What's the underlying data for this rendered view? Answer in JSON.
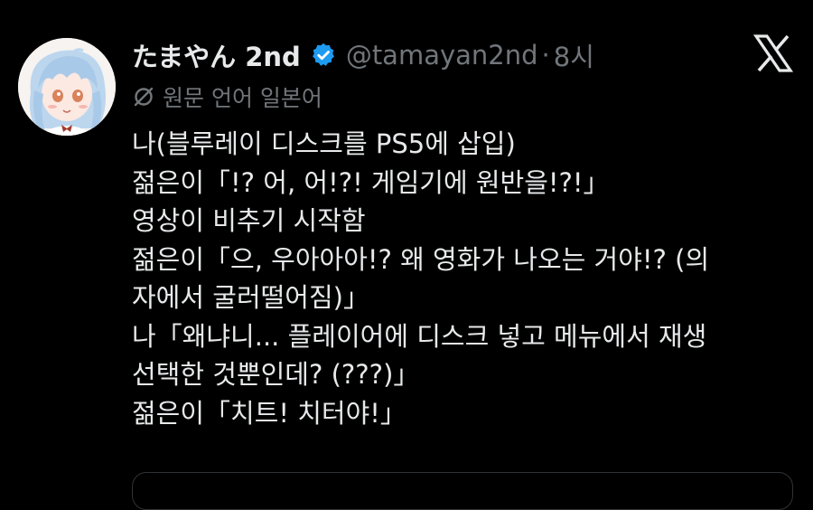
{
  "tweet": {
    "display_name": "たまやん 2nd",
    "handle": "@tamayan2nd",
    "separator": "·",
    "time": "8시",
    "original_language": "원문 언어 일본어",
    "body_lines": [
      "나(블루레이 디스크를 PS5에 삽입)",
      "젊은이「!? 어, 어!?! 게임기에 원반을!?!」",
      "영상이 비추기 시작함",
      "젊은이「으, 우아아아!? 왜 영화가 나오는 거야!? (의",
      "자에서 굴러떨어짐)」",
      "나「왜냐니... 플레이어에 디스크 넣고 메뉴에서 재생",
      "선택한 것뿐인데? (???)」",
      "젊은이「치트! 치터야!」"
    ]
  },
  "icons": {
    "verified": "verified-badge-icon",
    "x_logo": "x-logo-icon",
    "translate": "translate-icon"
  },
  "colors": {
    "background": "#000000",
    "primary_text": "#e7e9ea",
    "secondary_text": "#71767b",
    "verified_blue": "#1d9bf0"
  }
}
